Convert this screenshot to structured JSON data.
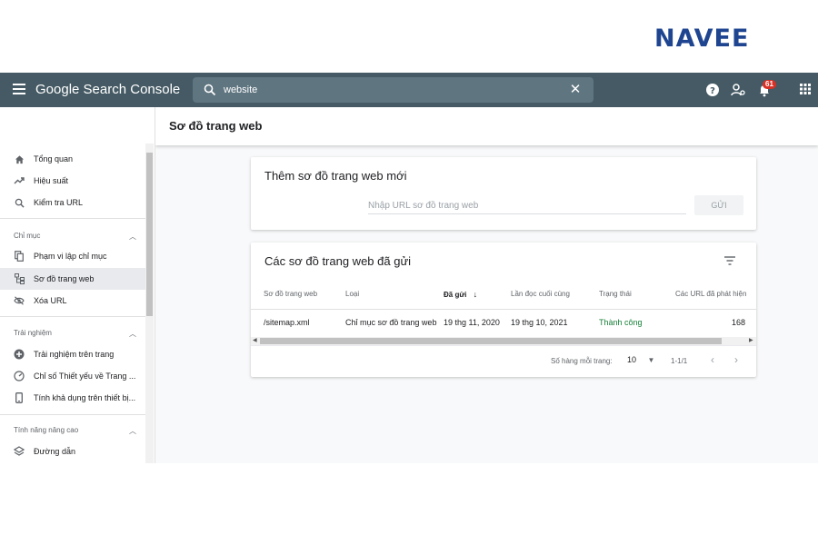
{
  "brand": {
    "logo_text": "NAVEE"
  },
  "appbar": {
    "title": "Google Search Console",
    "search_value": "website",
    "notification_count": "61",
    "icons": [
      "menu-icon",
      "search-icon",
      "close-icon",
      "help-icon",
      "user-settings-icon",
      "bell-icon",
      "apps-grid-icon"
    ]
  },
  "page": {
    "title": "Sơ đồ trang web"
  },
  "sidebar": {
    "items_top": [
      {
        "label": "Tổng quan",
        "icon": "home-icon"
      },
      {
        "label": "Hiệu suất",
        "icon": "trending-icon"
      },
      {
        "label": "Kiểm tra URL",
        "icon": "search-icon"
      }
    ],
    "section_index": {
      "label": "Chỉ mục",
      "items": [
        {
          "label": "Phạm vi lập chỉ mục",
          "icon": "copy-icon"
        },
        {
          "label": "Sơ đồ trang web",
          "icon": "sitemap-icon"
        },
        {
          "label": "Xóa URL",
          "icon": "eye-off-icon"
        }
      ]
    },
    "section_experience": {
      "label": "Trải nghiệm",
      "items": [
        {
          "label": "Trải nghiệm trên trang",
          "icon": "plus-circle-icon"
        },
        {
          "label": "Chỉ số Thiết yếu về Trang ...",
          "icon": "gauge-icon"
        },
        {
          "label": "Tính khả dụng trên thiết bị...",
          "icon": "phone-icon"
        }
      ]
    },
    "section_advanced": {
      "label": "Tính năng nâng cao",
      "items": [
        {
          "label": "Đường dẫn",
          "icon": "layers-icon"
        }
      ]
    }
  },
  "add_card": {
    "title": "Thêm sơ đồ trang web mới",
    "input_placeholder": "Nhập URL sơ đồ trang web",
    "submit_label": "GỬI"
  },
  "list_card": {
    "title": "Các sơ đồ trang web đã gửi",
    "columns": [
      "Sơ đồ trang web",
      "Loại",
      "Đã gửi",
      "Lần đọc cuối cùng",
      "Trạng thái",
      "Các URL đã phát hiện"
    ],
    "rows": [
      {
        "sitemap": "/sitemap.xml",
        "type": "Chỉ mục sơ đồ trang web",
        "submitted": "19 thg 11, 2020",
        "last_read": "19 thg 10, 2021",
        "status": "Thành công",
        "discovered": "168"
      }
    ],
    "footer": {
      "rows_per_page_label": "Số hàng mỗi trang:",
      "rows_per_page_value": "10",
      "range": "1-1/1"
    }
  },
  "colors": {
    "appbar": "#455a64",
    "brand": "#1f4591",
    "success": "#188038",
    "badge": "#d93025"
  }
}
